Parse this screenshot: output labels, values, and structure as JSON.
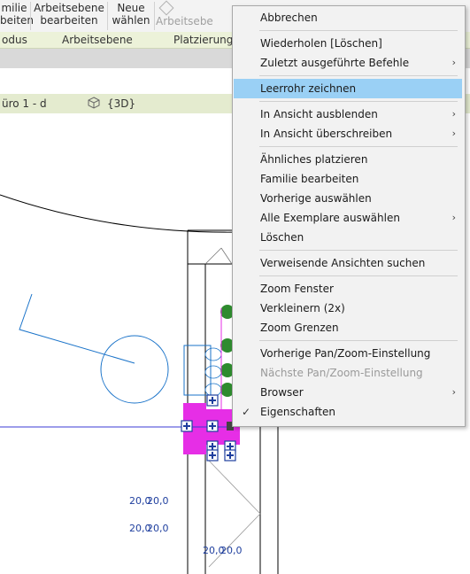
{
  "ribbon": {
    "btn1_l1": "milie",
    "btn1_l2": "beiten",
    "btn2_l1": "Arbeitsebene",
    "btn2_l2": "bearbeiten",
    "btn3_l1": "Neue",
    "btn3_l2": "wählen",
    "btn4": "Arbeitsebe"
  },
  "panels": {
    "p1": "odus",
    "p2": "Arbeitsebene",
    "p3": "Platzierung"
  },
  "tabs": {
    "t1": "üro 1 - d",
    "t2": "{3D}"
  },
  "context_menu": {
    "items": [
      {
        "label": "Abbrechen"
      },
      {
        "label": "Wiederholen [Löschen]"
      },
      {
        "label": "Zuletzt ausgeführte Befehle",
        "arrow": "›"
      },
      {
        "label": "Leerrohr zeichnen"
      },
      {
        "label": "In Ansicht ausblenden",
        "arrow": "›"
      },
      {
        "label": "In Ansicht überschreiben",
        "arrow": "›"
      },
      {
        "label": "Ähnliches platzieren"
      },
      {
        "label": "Familie bearbeiten"
      },
      {
        "label": "Vorherige auswählen"
      },
      {
        "label": "Alle Exemplare auswählen",
        "arrow": "›"
      },
      {
        "label": "Löschen"
      },
      {
        "label": "Verweisende Ansichten suchen"
      },
      {
        "label": "Zoom Fenster"
      },
      {
        "label": "Verkleinern (2x)"
      },
      {
        "label": "Zoom Grenzen"
      },
      {
        "label": "Vorherige Pan/Zoom-Einstellung"
      },
      {
        "label": "Nächste Pan/Zoom-Einstellung"
      },
      {
        "label": "Browser",
        "arrow": "›"
      },
      {
        "label": "Eigenschaften",
        "check": "✓"
      }
    ]
  },
  "dims": {
    "d1": "20,0",
    "d2": "20,0",
    "d3": "20,0",
    "d4": "20,0",
    "d5": "20,0",
    "d6": "20,0"
  },
  "colors": {
    "highlight": "#9ad0f5",
    "magenta": "#e62ee6",
    "element_blue": "#1a73c9",
    "dim_blue": "#1f3f9e"
  }
}
